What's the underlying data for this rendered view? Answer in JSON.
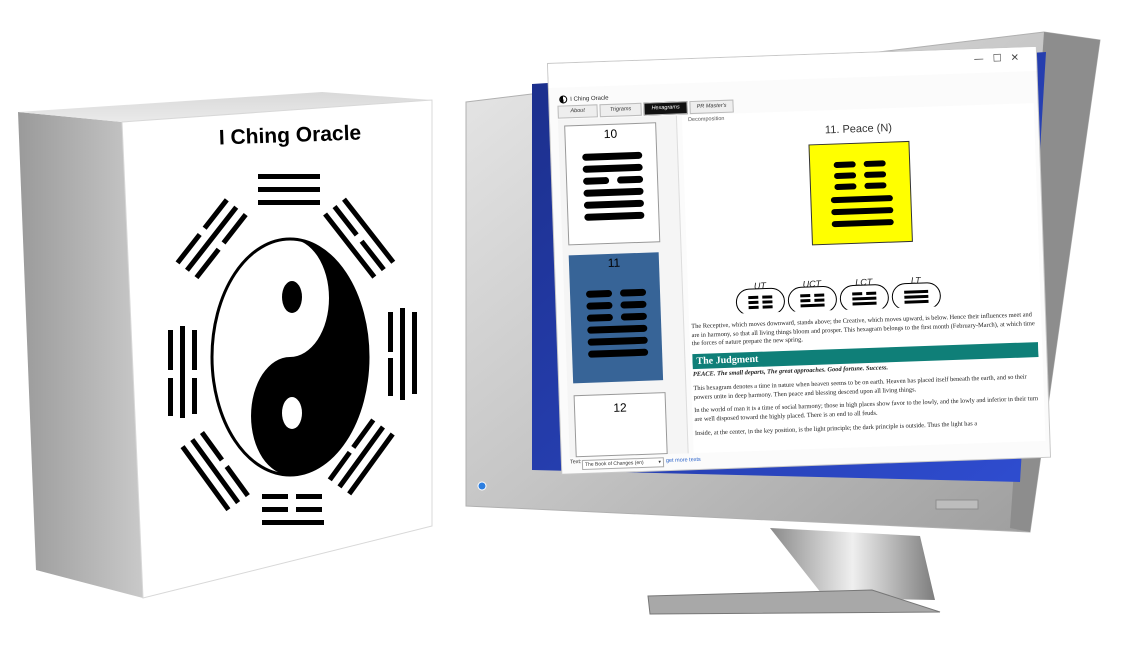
{
  "box": {
    "title": "I Ching Oracle"
  },
  "window": {
    "title": "I Ching Oracle",
    "controls": [
      "—",
      "☐",
      "✕"
    ],
    "tabs": [
      {
        "label": "About"
      },
      {
        "label": "Trigrams"
      },
      {
        "label": "Hexagrams"
      },
      {
        "label": "PR Master's"
      }
    ],
    "hexagram_cards": [
      {
        "number": "10"
      },
      {
        "number": "11"
      },
      {
        "number": "12"
      }
    ],
    "decomposition_label": "Decomposition",
    "hexagram_title": "11. Peace (N)",
    "trigram_labels": [
      "UT",
      "UCT",
      "LCT",
      "LT"
    ],
    "text": {
      "intro": "The Receptive, which moves downward, stands above; the Creative, which moves upward, is below. Hence their influences meet and are in harmony, so that all living things bloom and prosper. This hexagram belongs to the first month (February-March), at which time the forces of nature prepare the new spring.",
      "judgment_heading": "The Judgment",
      "judgment_line": "PEACE. The small departs, The great approaches. Good fortune. Success.",
      "p1": "This hexagram denotes a time in nature when heaven seems to be on earth. Heaven has placed itself beneath the earth, and so their powers unite in deep harmony. Then peace and blessing descend upon all living things.",
      "p2": "In the world of man it is a time of social harmony; those in high places show favor to the lowly, and the lowly and inferior in their turn are well disposed toward the highly placed. There is an end to all feuds.",
      "p3": "Inside, at the center, in the key position, is the light principle; the dark principle is outside. Thus the light has a"
    },
    "footer": {
      "text_label": "Text:",
      "selected_text": "The Book of Changes (en)",
      "more_link": "get more texts"
    }
  },
  "colors": {
    "highlight_yellow": "#ffff00",
    "selected_blue": "#376497",
    "judgment_teal": "#0f7f78"
  }
}
